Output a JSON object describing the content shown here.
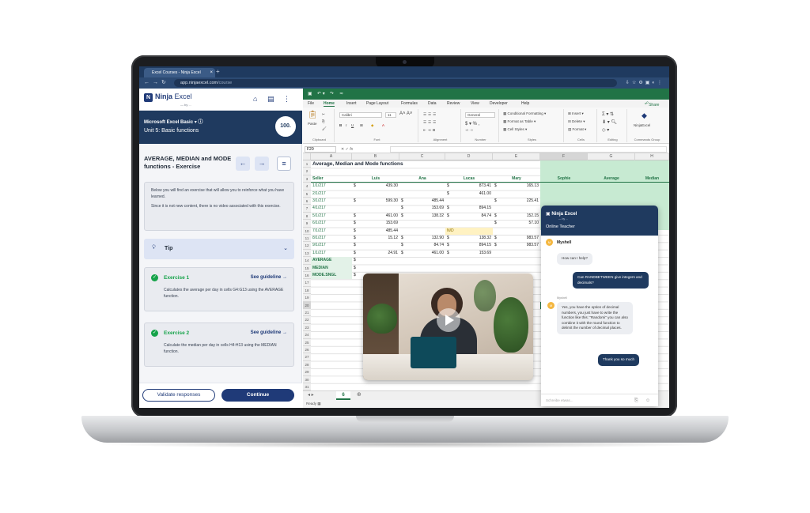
{
  "browser": {
    "tab_title": "Excel Courses - Ninja Excel",
    "url_host": "app.ninjaexcel.com",
    "url_path": "/course"
  },
  "course": {
    "brand_main": "Ninja",
    "brand_second": "Excel",
    "brand_sub": "— by ...",
    "course_name": "Microsoft Excel Basic",
    "unit": "Unit 5: Basic functions",
    "progress": "100.",
    "exercise_title": "AVERAGE, MEDIAN and MODE functions - Exercise",
    "info_p1": "Below you will find an exercise that will allow you to reinforce what you have learned.",
    "info_p2": "Since it is not new content, there is no video associated with this exercise.",
    "tip_label": "Tip",
    "exercises": [
      {
        "name": "Exercise 1",
        "guide": "See guideline",
        "desc": "Calculates the average per day in cells G4:G13 using the AVERAGE function."
      },
      {
        "name": "Exercise 2",
        "guide": "See guideline",
        "desc": "Calculate the median per day in cells H4:H13 using the MEDIAN function."
      }
    ],
    "validate_label": "Validate responses",
    "continue_label": "Continue"
  },
  "excel": {
    "menu": [
      "File",
      "Home",
      "Insert",
      "Page Layout",
      "Formulas",
      "Data",
      "Review",
      "View",
      "Developer",
      "Help"
    ],
    "share": "Share",
    "ribbon": {
      "clipboard": "Clipboard",
      "paste": "Paste",
      "font": "Font",
      "font_name": "Calibri",
      "font_size": "11",
      "alignment": "Alignment",
      "number": "Number",
      "number_format": "General",
      "styles": "Styles",
      "cond_format": "Conditional Formatting",
      "format_table": "Format as Table",
      "cell_styles": "Cell Styles",
      "cells": "Cells",
      "insert": "Insert",
      "delete": "Delete",
      "format": "Format",
      "editing": "Editing",
      "addin": "NinjaExcel",
      "commands_group": "Commands Group"
    },
    "name_box": "F20",
    "fx": "fx",
    "columns": [
      "A",
      "B",
      "C",
      "D",
      "E",
      "F",
      "G",
      "H"
    ],
    "sheet_title": "Average, Median and Mode functions",
    "headers": [
      "Seller",
      "Luis",
      "Ana",
      "Lucas",
      "Mary",
      "Sophie",
      "Average",
      "Median"
    ],
    "rows": [
      [
        "1/1/217",
        "$",
        "439.30",
        "",
        "",
        "$",
        "873.41",
        "$",
        "165.13"
      ],
      [
        "2/1/217",
        "",
        "",
        "",
        "",
        "$",
        "461.00",
        "",
        ""
      ],
      [
        "3/1/217",
        "$",
        "599.30",
        "$",
        "485.44",
        "",
        "",
        "$",
        "225.41"
      ],
      [
        "4/1/217",
        "",
        "",
        "$",
        "153.69",
        "$",
        "894.15",
        "",
        ""
      ],
      [
        "5/1/217",
        "$",
        "461.00",
        "$",
        "138.32",
        "$",
        "84.74",
        "$",
        "152.15"
      ],
      [
        "6/1/217",
        "$",
        "153.69",
        "",
        "",
        "",
        "",
        "$",
        "57.10"
      ],
      [
        "7/1/217",
        "$",
        "485.44",
        "",
        "",
        "N/D",
        "",
        "",
        ""
      ],
      [
        "8/1/217",
        "$",
        "15.12",
        "$",
        "132.90",
        "$",
        "138.32",
        "$",
        "983.57"
      ],
      [
        "9/1/217",
        "$",
        "",
        "$",
        "84.74",
        "$",
        "894.15",
        "$",
        "983.57"
      ],
      [
        "1/1/217",
        "$",
        "24.91",
        "$",
        "461.00",
        "$",
        "153.69",
        "",
        ""
      ]
    ],
    "summary": [
      "AVERAGE",
      "MEDIAN",
      "MODE.SNGL"
    ],
    "summary_tails": [
      ".82",
      ".64",
      ".57"
    ],
    "sheet_tab": "6",
    "status": "Ready"
  },
  "chat": {
    "brand": "Ninja Excel",
    "brand_sub": "— by ...",
    "title": "Online Teacher",
    "agent": "Myshell",
    "agent_initial": "M",
    "m1": "How can I help?",
    "m2": "Can RANDBETWEEN give integers and decimals?",
    "reply_name": "Myshell",
    "m3": "Yes, you have the option of decimal numbers, you just have to write the function like this: \"Randomi\" you can also combine it with the round function to delimit the number of decimal places.",
    "m4": "Thank you so much",
    "input_placeholder": "Schreibe etwas..."
  }
}
